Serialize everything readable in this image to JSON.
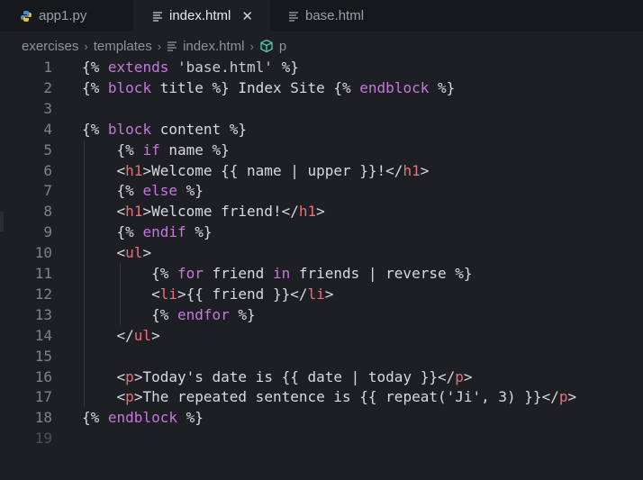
{
  "tabs": [
    {
      "label": "app1.py",
      "icon": "python-icon",
      "active": false
    },
    {
      "label": "index.html",
      "icon": "lines-file-icon",
      "active": true,
      "close": "✕"
    },
    {
      "label": "base.html",
      "icon": "lines-file-icon",
      "active": false
    }
  ],
  "breadcrumb": {
    "items": [
      "exercises",
      "templates",
      "index.html",
      "p"
    ],
    "separator": "›"
  },
  "colors": {
    "keyword": "#c678dd",
    "tag": "#e5727a",
    "text": "#d7dae0",
    "line_number": "#7d828c",
    "background": "#1e1f24"
  },
  "lines": [
    {
      "n": "1",
      "tokens": [
        [
          "t-br",
          "{% "
        ],
        [
          "t-kw",
          "extends"
        ],
        [
          "t-str",
          " 'base.html' "
        ],
        [
          "t-br",
          "%}"
        ]
      ]
    },
    {
      "n": "2",
      "tokens": [
        [
          "t-br",
          "{% "
        ],
        [
          "t-kw",
          "block"
        ],
        [
          "t-text",
          " title "
        ],
        [
          "t-br",
          "%}"
        ],
        [
          "t-text",
          " Index Site "
        ],
        [
          "t-br",
          "{% "
        ],
        [
          "t-kw",
          "endblock"
        ],
        [
          "t-br",
          " %}"
        ]
      ]
    },
    {
      "n": "3",
      "tokens": []
    },
    {
      "n": "4",
      "tokens": [
        [
          "t-br",
          "{% "
        ],
        [
          "t-kw",
          "block"
        ],
        [
          "t-text",
          " content "
        ],
        [
          "t-br",
          "%}"
        ]
      ]
    },
    {
      "n": "5",
      "tokens": [
        [
          "t-text",
          "    "
        ],
        [
          "t-br",
          "{% "
        ],
        [
          "t-kw",
          "if"
        ],
        [
          "t-text",
          " name "
        ],
        [
          "t-br",
          "%}"
        ]
      ]
    },
    {
      "n": "6",
      "tokens": [
        [
          "t-text",
          "    "
        ],
        [
          "t-br",
          "<"
        ],
        [
          "t-tag",
          "h1"
        ],
        [
          "t-br",
          ">"
        ],
        [
          "t-text",
          "Welcome {{ name | upper }}!"
        ],
        [
          "t-br",
          "</"
        ],
        [
          "t-tag",
          "h1"
        ],
        [
          "t-br",
          ">"
        ]
      ]
    },
    {
      "n": "7",
      "tokens": [
        [
          "t-text",
          "    "
        ],
        [
          "t-br",
          "{% "
        ],
        [
          "t-kw",
          "else"
        ],
        [
          "t-br",
          " %}"
        ]
      ]
    },
    {
      "n": "8",
      "tokens": [
        [
          "t-text",
          "    "
        ],
        [
          "t-br",
          "<"
        ],
        [
          "t-tag",
          "h1"
        ],
        [
          "t-br",
          ">"
        ],
        [
          "t-text",
          "Welcome friend!"
        ],
        [
          "t-br",
          "</"
        ],
        [
          "t-tag",
          "h1"
        ],
        [
          "t-br",
          ">"
        ]
      ]
    },
    {
      "n": "9",
      "tokens": [
        [
          "t-text",
          "    "
        ],
        [
          "t-br",
          "{% "
        ],
        [
          "t-kw",
          "endif"
        ],
        [
          "t-br",
          " %}"
        ]
      ]
    },
    {
      "n": "10",
      "tokens": [
        [
          "t-text",
          "    "
        ],
        [
          "t-br",
          "<"
        ],
        [
          "t-tag",
          "ul"
        ],
        [
          "t-br",
          ">"
        ]
      ]
    },
    {
      "n": "11",
      "tokens": [
        [
          "t-text",
          "        "
        ],
        [
          "t-br",
          "{% "
        ],
        [
          "t-kw",
          "for"
        ],
        [
          "t-text",
          " friend "
        ],
        [
          "t-kw",
          "in"
        ],
        [
          "t-text",
          " friends | reverse "
        ],
        [
          "t-br",
          "%}"
        ]
      ]
    },
    {
      "n": "12",
      "tokens": [
        [
          "t-text",
          "        "
        ],
        [
          "t-br",
          "<"
        ],
        [
          "t-tag",
          "li"
        ],
        [
          "t-br",
          ">"
        ],
        [
          "t-text",
          "{{ friend }}"
        ],
        [
          "t-br",
          "</"
        ],
        [
          "t-tag",
          "li"
        ],
        [
          "t-br",
          ">"
        ]
      ]
    },
    {
      "n": "13",
      "tokens": [
        [
          "t-text",
          "        "
        ],
        [
          "t-br",
          "{% "
        ],
        [
          "t-kw",
          "endfor"
        ],
        [
          "t-br",
          " %}"
        ]
      ]
    },
    {
      "n": "14",
      "tokens": [
        [
          "t-text",
          "    "
        ],
        [
          "t-br",
          "</"
        ],
        [
          "t-tag",
          "ul"
        ],
        [
          "t-br",
          ">"
        ]
      ]
    },
    {
      "n": "15",
      "tokens": []
    },
    {
      "n": "16",
      "tokens": [
        [
          "t-text",
          "    "
        ],
        [
          "t-br",
          "<"
        ],
        [
          "t-tag",
          "p"
        ],
        [
          "t-br",
          ">"
        ],
        [
          "t-text",
          "Today's date is {{ date | today }}"
        ],
        [
          "t-br",
          "</"
        ],
        [
          "t-tag",
          "p"
        ],
        [
          "t-br",
          ">"
        ]
      ]
    },
    {
      "n": "17",
      "tokens": [
        [
          "t-text",
          "    "
        ],
        [
          "t-br",
          "<"
        ],
        [
          "t-tag",
          "p"
        ],
        [
          "t-br",
          ">"
        ],
        [
          "t-text",
          "The repeated sentence is {{ repeat('Ji', 3) }}"
        ],
        [
          "t-br",
          "</"
        ],
        [
          "t-tag",
          "p"
        ],
        [
          "t-br",
          ">"
        ]
      ]
    },
    {
      "n": "18",
      "tokens": [
        [
          "t-br",
          "{% "
        ],
        [
          "t-kw",
          "endblock"
        ],
        [
          "t-br",
          " %}"
        ]
      ]
    },
    {
      "n": "19",
      "tokens": []
    }
  ]
}
